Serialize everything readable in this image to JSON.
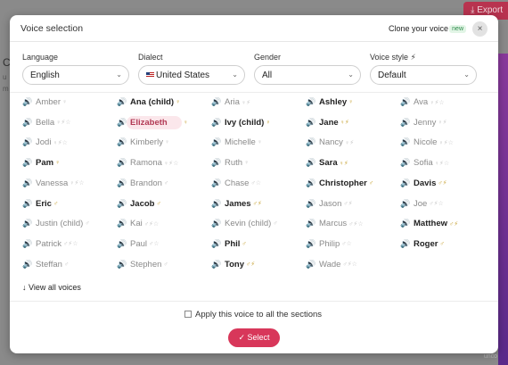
{
  "background": {
    "export_label": "Export",
    "left_letter": "C",
    "left_lines": [
      "u",
      "m"
    ],
    "right_text": "unco"
  },
  "modal": {
    "title": "Voice selection",
    "clone_label": "Clone your voice",
    "new_badge": "new",
    "close_icon": "×"
  },
  "filters": {
    "language": {
      "label": "Language",
      "value": "English"
    },
    "dialect": {
      "label": "Dialect",
      "value": "United States"
    },
    "gender": {
      "label": "Gender",
      "value": "All"
    },
    "style": {
      "label": "Voice style ⚡",
      "value": "Default"
    }
  },
  "voices": [
    [
      "Amber",
      "♀",
      "light"
    ],
    [
      "Ana (child)",
      "♀",
      "bold"
    ],
    [
      "Aria",
      "♀⚡",
      "light"
    ],
    [
      "Ashley",
      "♀",
      "bold"
    ],
    [
      "Ava",
      "♀⚡☆",
      "light"
    ],
    [
      "Bella",
      "♀⚡☆",
      "light"
    ],
    [
      "Elizabeth",
      "♀",
      "sel"
    ],
    [
      "Ivy (child)",
      "♀",
      "bold"
    ],
    [
      "Jane",
      "♀⚡",
      "bold"
    ],
    [
      "Jenny",
      "♀⚡",
      "light"
    ],
    [
      "Jodi",
      "♀⚡☆",
      "light"
    ],
    [
      "Kimberly",
      "♀",
      "light"
    ],
    [
      "Michelle",
      "♀",
      "light"
    ],
    [
      "Nancy",
      "♀⚡",
      "light"
    ],
    [
      "Nicole",
      "♀⚡☆",
      "light"
    ],
    [
      "Pam",
      "♀",
      "bold"
    ],
    [
      "Ramona",
      "♀⚡☆",
      "light"
    ],
    [
      "Ruth",
      "♀",
      "light"
    ],
    [
      "Sara",
      "♀⚡",
      "bold"
    ],
    [
      "Sofia",
      "♀⚡☆",
      "light"
    ],
    [
      "Vanessa",
      "♀⚡☆",
      "light"
    ],
    [
      "Brandon",
      "♂",
      "light"
    ],
    [
      "Chase",
      "♂☆",
      "light"
    ],
    [
      "Christopher",
      "♂",
      "bold"
    ],
    [
      "Davis",
      "♂⚡",
      "bold"
    ],
    [
      "Eric",
      "♂",
      "bold"
    ],
    [
      "Jacob",
      "♂",
      "bold"
    ],
    [
      "James",
      "♂⚡",
      "bold"
    ],
    [
      "Jason",
      "♂⚡",
      "light"
    ],
    [
      "Joe",
      "♂⚡☆",
      "light"
    ],
    [
      "Justin (child)",
      "♂",
      "light"
    ],
    [
      "Kai",
      "♂⚡☆",
      "light"
    ],
    [
      "Kevin (child)",
      "♂",
      "light"
    ],
    [
      "Marcus",
      "♂⚡☆",
      "light"
    ],
    [
      "Matthew",
      "♂⚡",
      "bold"
    ],
    [
      "Patrick",
      "♂⚡☆",
      "light"
    ],
    [
      "Paul",
      "♂☆",
      "light"
    ],
    [
      "Phil",
      "♂",
      "bold"
    ],
    [
      "Philip",
      "♂☆",
      "light"
    ],
    [
      "Roger",
      "♂",
      "bold"
    ],
    [
      "Steffan",
      "♂",
      "light"
    ],
    [
      "Stephen",
      "♂",
      "light"
    ],
    [
      "Tony",
      "♂⚡",
      "bold"
    ],
    [
      "Wade",
      "♂⚡☆",
      "light"
    ]
  ],
  "view_all": "↓ View all voices",
  "apply_label": "Apply this voice to all the sections",
  "select_label": "✓  Select",
  "colors": {
    "accent": "#d8375a",
    "selected_bg": "#fbe7eb"
  }
}
